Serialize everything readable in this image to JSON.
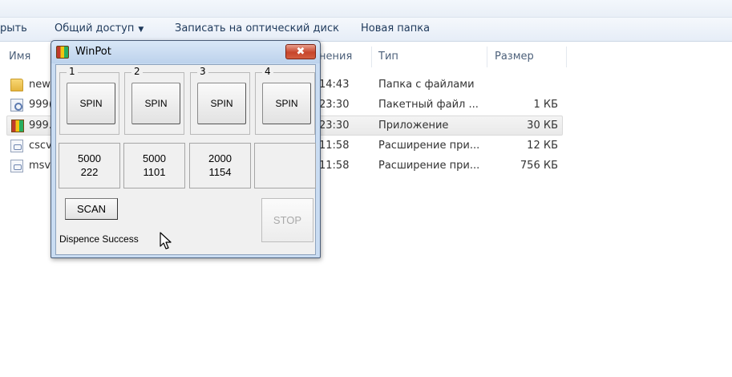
{
  "top_strip": {
    "cut_text": "… (?) … … …"
  },
  "toolbar": {
    "open_label": "рыть",
    "share_label": "Общий доступ",
    "burn_label": "Записать на оптический диск",
    "new_folder_label": "Новая папка"
  },
  "columns": {
    "name": "Имя",
    "date_partial": "нения",
    "type": "Тип",
    "size": "Размер"
  },
  "files": [
    {
      "name": "new",
      "time": "14:43",
      "type": "Папка с файлами",
      "size": "",
      "icon": "folder-icon"
    },
    {
      "name": "999(",
      "time": "23:30",
      "type": "Пакетный файл ...",
      "size": "1 КБ",
      "icon": "batch-file-icon"
    },
    {
      "name": "999.",
      "time": "23:30",
      "type": "Приложение",
      "size": "30 КБ",
      "icon": "slot-app-icon"
    },
    {
      "name": "cscv",
      "time": "11:58",
      "type": "Расширение при...",
      "size": "12 КБ",
      "icon": "dll-icon"
    },
    {
      "name": "msv",
      "time": "11:58",
      "type": "Расширение при...",
      "size": "756 КБ",
      "icon": "dll-icon"
    }
  ],
  "winpot": {
    "title": "WinPot",
    "close_symbol": "✖",
    "groups": [
      {
        "label": "1",
        "button": "SPIN",
        "value_top": "5000",
        "value_bottom": "222"
      },
      {
        "label": "2",
        "button": "SPIN",
        "value_top": "5000",
        "value_bottom": "1101"
      },
      {
        "label": "3",
        "button": "SPIN",
        "value_top": "2000",
        "value_bottom": "1154"
      },
      {
        "label": "4",
        "button": "SPIN",
        "value_top": "",
        "value_bottom": ""
      }
    ],
    "scan_label": "SCAN",
    "stop_label": "STOP",
    "status_text": "Dispence Success"
  }
}
